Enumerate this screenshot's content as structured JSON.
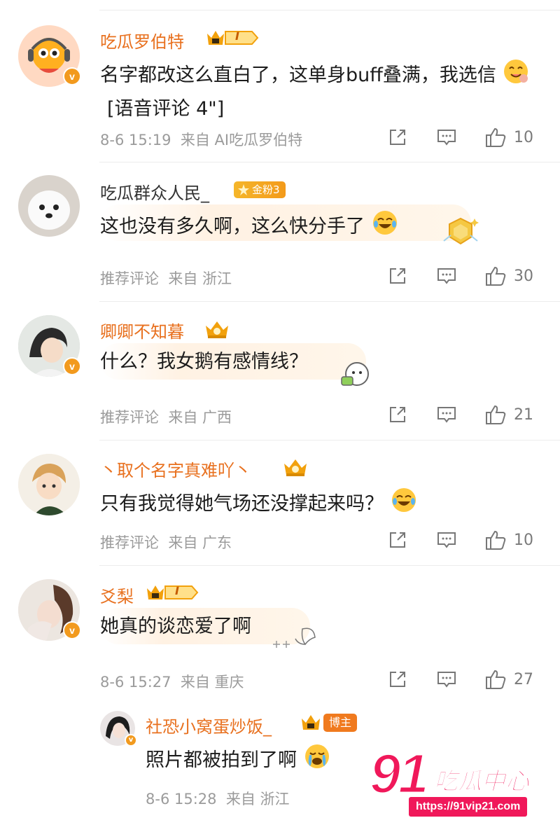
{
  "comments": [
    {
      "name": "吃瓜罗伯特",
      "badge": "I",
      "text": "名字都改这么直白了，这单身buff叠满，我选信",
      "tail": "[语音评论 4\"]",
      "time": "8-6 15:19",
      "source": "来自 AI吃瓜罗伯特",
      "likes": "10"
    },
    {
      "name": "吃瓜群众人民_",
      "badge": "金粉3",
      "text": "这也没有多久啊，这么快分手了",
      "time": "推荐评论",
      "source": "来自 浙江",
      "likes": "30"
    },
    {
      "name": "卿卿不知暮",
      "text": "什么？我女鹅有感情线？",
      "time": "推荐评论",
      "source": "来自 广西",
      "likes": "21"
    },
    {
      "name": "丶取个名字真难吖丶",
      "text": "只有我觉得她气场还没撑起来吗？",
      "time": "推荐评论",
      "source": "来自 广东",
      "likes": "10"
    },
    {
      "name": "爻梨",
      "badge": "I",
      "text": "她真的谈恋爱了啊",
      "time": "8-6 15:27",
      "source": "来自 重庆",
      "likes": "27"
    }
  ],
  "reply": {
    "name": "社恐小窝蛋炒饭_",
    "badge": "博主",
    "text": "照片都被拍到了啊",
    "time": "8-6 15:28",
    "source": "来自 浙江"
  },
  "watermark": {
    "big": "91",
    "title": "吃瓜中心",
    "url": "https://91vip21.com"
  },
  "colors": {
    "name_orange": "#e8701e",
    "meta_gray": "#9b9b9b",
    "watermark_pink": "#f0185a"
  }
}
